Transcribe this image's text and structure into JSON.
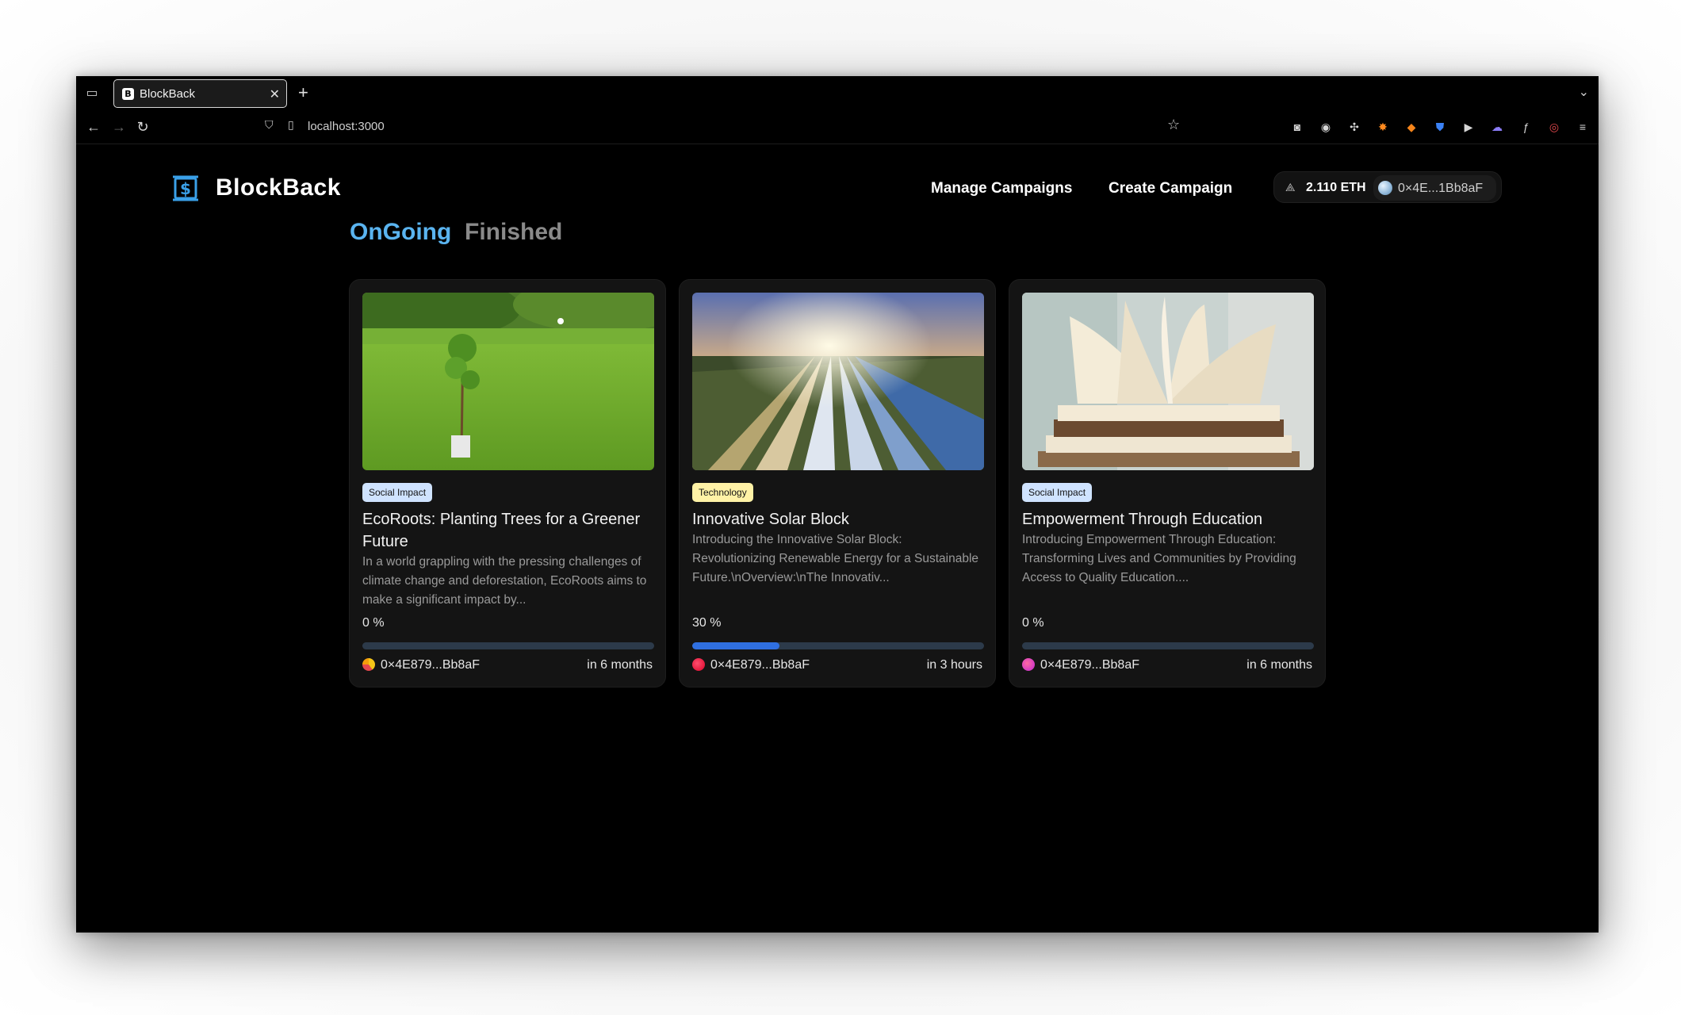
{
  "browser": {
    "tab_title": "BlockBack",
    "favicon_letter": "B",
    "url": "localhost:3000"
  },
  "header": {
    "brand": "BlockBack",
    "nav": [
      "Manage Campaigns",
      "Create Campaign"
    ],
    "wallet": {
      "balance": "2.110 ETH",
      "address": "0×4E...1Bb8aF"
    }
  },
  "tabs": {
    "ongoing": "OnGoing",
    "finished": "Finished"
  },
  "colors": {
    "accent": "#5ab4f0",
    "progress": "#2f6fe0",
    "badge_social": "#cfe3ff",
    "badge_tech": "#fff2a6"
  },
  "campaigns": [
    {
      "category": "Social Impact",
      "title": "EcoRoots: Planting Trees for a Greener Future",
      "description": "In a world grappling with the pressing challenges of climate change and deforestation, EcoRoots aims to make a significant impact by...",
      "progress_label": "0 %",
      "progress": 0,
      "owner": "0×4E879...Bb8aF",
      "deadline": "in 6 months"
    },
    {
      "category": "Technology",
      "title": "Innovative Solar Block",
      "description": "Introducing the Innovative Solar Block: Revolutionizing Renewable Energy for a Sustainable Future.\\nOverview:\\nThe Innovativ...",
      "progress_label": "30 %",
      "progress": 30,
      "owner": "0×4E879...Bb8aF",
      "deadline": "in 3 hours"
    },
    {
      "category": "Social Impact",
      "title": "Empowerment Through Education",
      "description": "Introducing Empowerment Through Education: Transforming Lives and Communities by Providing Access to Quality Education....",
      "progress_label": "0 %",
      "progress": 0,
      "owner": "0×4E879...Bb8aF",
      "deadline": "in 6 months"
    }
  ]
}
